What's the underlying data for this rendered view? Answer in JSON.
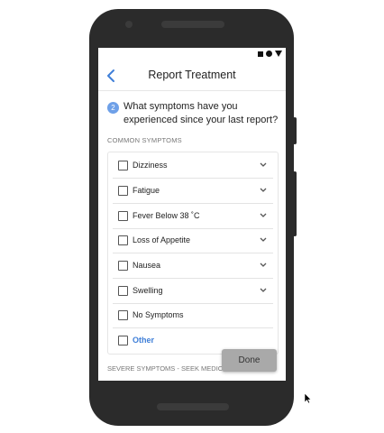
{
  "status_bar": {
    "icons": [
      "stop-square-icon",
      "record-dot-icon",
      "signal-triangle-icon"
    ]
  },
  "header": {
    "title": "Report Treatment",
    "back_icon": "chevron-left-icon"
  },
  "question": {
    "number": "2",
    "text": "What symptoms have you experienced since your last report?"
  },
  "sections": {
    "common": "COMMON SYMPTOMS",
    "severe": "SEVERE SYMPTOMS - SEEK MEDICA"
  },
  "symptoms": [
    {
      "label": "Dizziness",
      "checked": false,
      "expandable": true
    },
    {
      "label": "Fatigue",
      "checked": false,
      "expandable": true
    },
    {
      "label": "Fever Below 38 ˚C",
      "checked": false,
      "expandable": true
    },
    {
      "label": "Loss of Appetite",
      "checked": false,
      "expandable": true
    },
    {
      "label": "Nausea",
      "checked": false,
      "expandable": true
    },
    {
      "label": "Swelling",
      "checked": false,
      "expandable": true
    },
    {
      "label": "No Symptoms",
      "checked": false,
      "expandable": false
    },
    {
      "label": "Other",
      "checked": false,
      "expandable": false
    }
  ],
  "done_button": {
    "label": "Done"
  },
  "colors": {
    "accent": "#3f7fd8",
    "badge": "#6ea0e8",
    "done_bg": "#a9a9a9",
    "phone_body": "#2b2b2b"
  }
}
